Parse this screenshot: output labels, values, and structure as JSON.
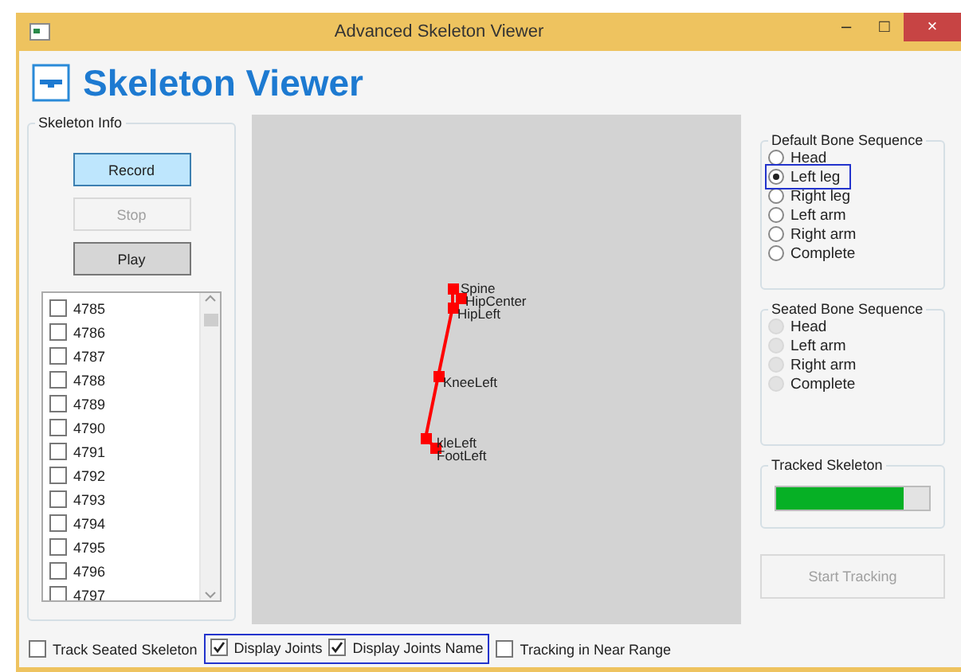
{
  "window": {
    "title": "Advanced Skeleton Viewer",
    "controls": [
      "–",
      "□",
      "×"
    ]
  },
  "header": {
    "title": "Skeleton Viewer"
  },
  "skeleton_info": {
    "title": "Skeleton Info",
    "buttons": [
      {
        "label": "Record",
        "kind": "primary",
        "disabled": false
      },
      {
        "label": "Stop",
        "kind": "normal",
        "disabled": true
      },
      {
        "label": "Play",
        "kind": "pressed",
        "disabled": false
      }
    ],
    "list": [
      {
        "label": "4785",
        "checked": false
      },
      {
        "label": "4786",
        "checked": false
      },
      {
        "label": "4787",
        "checked": false
      },
      {
        "label": "4788",
        "checked": false
      },
      {
        "label": "4789",
        "checked": false
      },
      {
        "label": "4790",
        "checked": false
      },
      {
        "label": "4791",
        "checked": false
      },
      {
        "label": "4792",
        "checked": false
      },
      {
        "label": "4793",
        "checked": false
      },
      {
        "label": "4794",
        "checked": false
      },
      {
        "label": "4795",
        "checked": false
      },
      {
        "label": "4796",
        "checked": false
      },
      {
        "label": "4797",
        "checked": false
      }
    ]
  },
  "canvas": {
    "joints": [
      {
        "name": "Spine"
      },
      {
        "name": "HipCenter"
      },
      {
        "name": "HipLeft"
      },
      {
        "name": "KneeLeft"
      },
      {
        "name": "kleLeft"
      },
      {
        "name": "FootLeft"
      }
    ]
  },
  "default_bone_sequence": {
    "title": "Default Bone Sequence",
    "options": [
      {
        "label": "Head",
        "selected": false,
        "disabled": false
      },
      {
        "label": "Left leg",
        "selected": true,
        "disabled": false,
        "highlighted": true
      },
      {
        "label": "Right leg",
        "selected": false,
        "disabled": false
      },
      {
        "label": "Left arm",
        "selected": false,
        "disabled": false
      },
      {
        "label": "Right arm",
        "selected": false,
        "disabled": false
      },
      {
        "label": "Complete",
        "selected": false,
        "disabled": false
      }
    ]
  },
  "seated_bone_sequence": {
    "title": "Seated Bone Sequence",
    "options": [
      {
        "label": "Head",
        "selected": false,
        "disabled": true
      },
      {
        "label": "Left arm",
        "selected": false,
        "disabled": true
      },
      {
        "label": "Right arm",
        "selected": false,
        "disabled": true
      },
      {
        "label": "Complete",
        "selected": false,
        "disabled": true
      }
    ]
  },
  "tracked_skeleton": {
    "title": "Tracked Skeleton",
    "level": 0.83
  },
  "start_tracking": {
    "label": "Start Tracking",
    "disabled": true
  },
  "options": [
    {
      "label": "Track Seated Skeleton",
      "checked": false
    },
    {
      "label": "Display Joints",
      "checked": true,
      "highlighted": true
    },
    {
      "label": "Display Joints Name",
      "checked": true,
      "highlighted": true
    },
    {
      "label": "Tracking in Near Range",
      "checked": false
    }
  ]
}
